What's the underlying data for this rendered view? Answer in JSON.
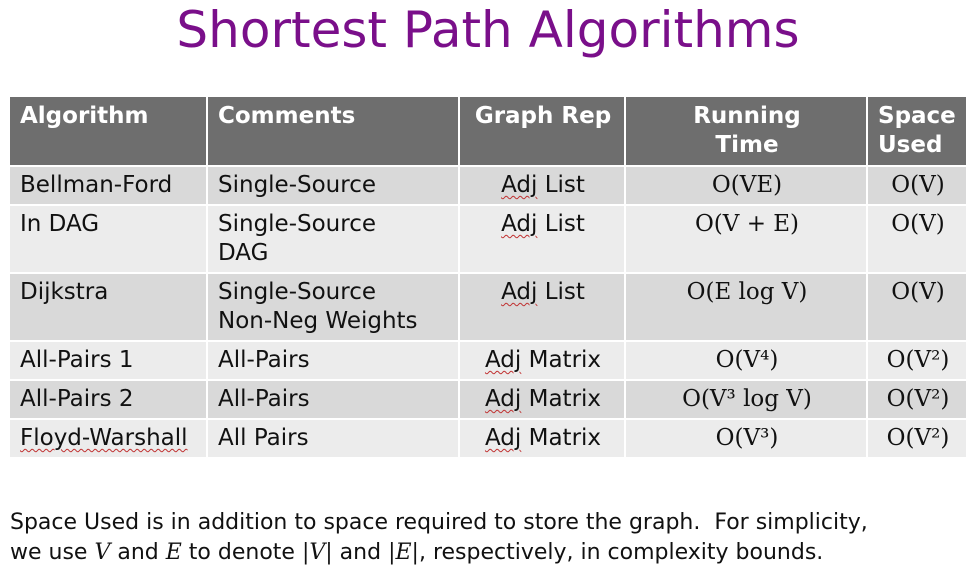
{
  "title": "Shortest Path Algorithms",
  "table": {
    "headers": {
      "algorithm": "Algorithm",
      "comments": "Comments",
      "graph_rep": "Graph Rep",
      "running_line1": "Running",
      "running_line2": "Time",
      "space_line1": "Space",
      "space_line2": "Used"
    },
    "rows": [
      {
        "algorithm": "Bellman-Ford",
        "comments_line1": "Single-Source",
        "comments_line2": "",
        "rep_word": "Adj",
        "rep_rest": " List",
        "running": "O(VE)",
        "space": "O(V)"
      },
      {
        "algorithm": "In DAG",
        "comments_line1": "Single-Source",
        "comments_line2": "DAG",
        "rep_word": "Adj",
        "rep_rest": " List",
        "running": "O(V + E)",
        "space": "O(V)"
      },
      {
        "algorithm": "Dijkstra",
        "comments_line1": "Single-Source",
        "comments_line2": "Non-Neg Weights",
        "rep_word": "Adj",
        "rep_rest": " List",
        "running": "O(E log V)",
        "space": "O(V)"
      },
      {
        "algorithm": "All-Pairs 1",
        "comments_line1": "All-Pairs",
        "comments_line2": "",
        "rep_word": "Adj",
        "rep_rest": " Matrix",
        "running": "O(V⁴)",
        "space": "O(V²)"
      },
      {
        "algorithm": "All-Pairs 2",
        "comments_line1": "All-Pairs",
        "comments_line2": "",
        "rep_word": "Adj",
        "rep_rest": " Matrix",
        "running": "O(V³ log V)",
        "space": "O(V²)"
      },
      {
        "algorithm": "Floyd-Warshall",
        "comments_line1": "All Pairs",
        "comments_line2": "",
        "rep_word": "Adj",
        "rep_rest": " Matrix",
        "running": "O(V³)",
        "space": "O(V²)"
      }
    ]
  },
  "note": {
    "line1": "Space Used is in addition to space required to store the graph.  For simplicity,",
    "line2_a": "we use ",
    "v": "V",
    "line2_b": " and ",
    "e": "E",
    "line2_c": " to denote ",
    "abs_v": "|V|",
    "line2_d": " and ",
    "abs_e": "|E|",
    "line2_e": ", respectively, in complexity bounds."
  },
  "colors": {
    "title": "#7a0f8a",
    "header_bg": "#6e6e6e",
    "row_dark": "#d9d9d9",
    "row_light": "#ececec"
  }
}
